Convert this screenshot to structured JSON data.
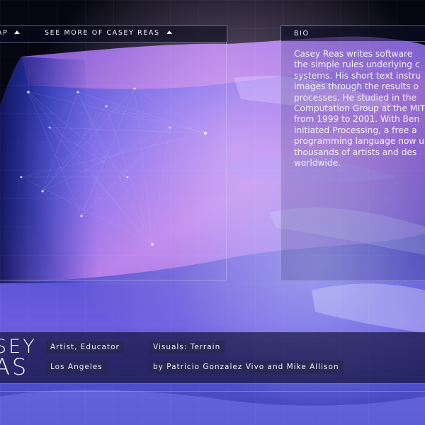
{
  "nav": {
    "map_label": "AP",
    "more_label": "SEE MORE OF CASEY REAS"
  },
  "bio": {
    "title": "BIO",
    "lines": [
      "Casey Reas writes software",
      "the simple rules underlying c",
      "systems. His short text instru",
      "images through the results o",
      "processes. He studied in the",
      "Computation Group at the MIT",
      "from 1999 to 2001. With Ben",
      "initiated Processing, a free a",
      "programming language now u",
      "thousands of artists and des",
      "worldwide."
    ]
  },
  "artist": {
    "name_line1": "SEY",
    "name_line2": "AS",
    "role": "Artist, Educator",
    "location": "Los Angeles",
    "visuals": "Visuals: Terrain",
    "credit": "by Patricio Gonzalez Vivo and Mike Allison"
  },
  "colors": {
    "background": "#05060f",
    "terrain_violet": "#8a6cf0",
    "terrain_blue": "#3a5ad8",
    "terrain_pink": "#d88ae8",
    "panel_border": "#c8c8e6"
  },
  "icons": {
    "caret": "caret-up-icon"
  }
}
